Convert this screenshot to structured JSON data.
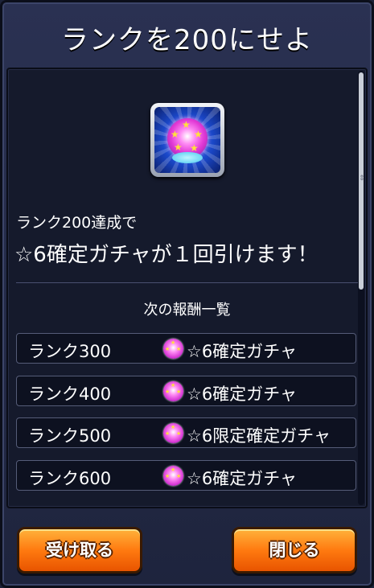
{
  "title": "ランクを200にせよ",
  "reward_icon": "gacha-ball-icon",
  "description": {
    "condition": "ランク200達成で",
    "reward": "☆6確定ガチャが１回引けます！"
  },
  "next_rewards": {
    "header": "次の報酬一覧",
    "items": [
      {
        "rank": "ランク300",
        "icon": "gacha-ball-icon",
        "reward": "☆6確定ガチャ"
      },
      {
        "rank": "ランク400",
        "icon": "gacha-ball-icon",
        "reward": "☆6確定ガチャ"
      },
      {
        "rank": "ランク500",
        "icon": "gacha-ball-icon",
        "reward": "☆6限定確定ガチャ"
      },
      {
        "rank": "ランク600",
        "icon": "gacha-ball-icon",
        "reward": "☆6確定ガチャ"
      }
    ]
  },
  "buttons": {
    "receive": "受け取る",
    "close": "閉じる"
  },
  "colors": {
    "button_accent": "#ff7a10",
    "panel_bg": "#151a2c",
    "frame_bg": "#2a3152"
  }
}
